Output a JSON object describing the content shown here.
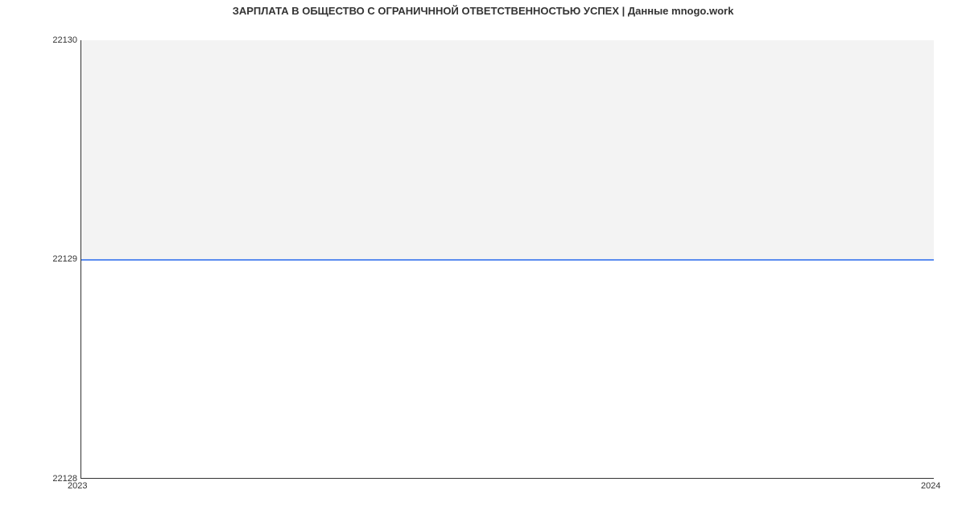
{
  "chart_data": {
    "type": "line",
    "title": "ЗАРПЛАТА В ОБЩЕСТВО С ОГРАНИЧННОЙ ОТВЕТСТВЕННОСТЬЮ УСПЕХ | Данные mnogo.work",
    "x": [
      2023,
      2024
    ],
    "values": [
      22129,
      22129
    ],
    "xlabel": "",
    "ylabel": "",
    "ylim": [
      22128,
      22130
    ],
    "xlim": [
      2023,
      2024
    ],
    "y_ticks": [
      22128,
      22129,
      22130
    ],
    "x_ticks": [
      2023,
      2024
    ],
    "line_color": "#5b8def"
  }
}
